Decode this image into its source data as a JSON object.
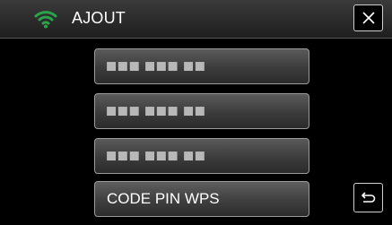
{
  "header": {
    "title": "AJOUT",
    "wifi_icon": "wifi-icon",
    "close_icon": "close-icon"
  },
  "list": {
    "items": [
      {
        "label": "■■■ ■■■ ■■",
        "masked": true
      },
      {
        "label": "■■■ ■■■ ■■",
        "masked": true
      },
      {
        "label": "■■■ ■■■ ■■",
        "masked": true
      },
      {
        "label": "CODE PIN WPS",
        "masked": false
      }
    ]
  },
  "footer": {
    "back_icon": "back-icon"
  },
  "colors": {
    "wifi": "#2aa34a",
    "background": "#000000",
    "button_border": "#9c9c9c",
    "text": "#ffffff"
  }
}
